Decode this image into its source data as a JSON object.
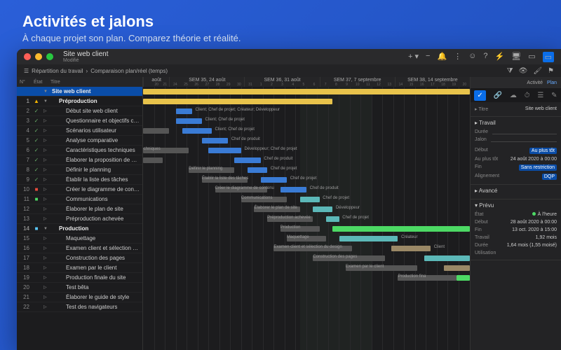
{
  "hero": {
    "title": "Activités et jalons",
    "subtitle": "À chaque projet son plan. Comparez théorie et réalité."
  },
  "window": {
    "title": "Site web client",
    "subtitle": "Modifié"
  },
  "breadcrumbs": {
    "seg1": "Répartition du travail",
    "seg2": "Comparaison plan/réel (temps)"
  },
  "left_header": {
    "num": "N°",
    "state": "État",
    "title": "Titre"
  },
  "right_tabs": {
    "a": "Activité",
    "b": "Plan"
  },
  "tasks": [
    {
      "n": "",
      "st": "",
      "tri": "▼",
      "t": "Site web client",
      "cls": "sel bold",
      "ind": 0
    },
    {
      "n": "1",
      "st": "▲",
      "sc": "warn",
      "tri": "▼",
      "t": "Préproduction",
      "cls": "bold",
      "ind": 1
    },
    {
      "n": "2",
      "st": "✓",
      "sc": "ck",
      "tri": "▷",
      "t": "Début site web client",
      "ind": 2
    },
    {
      "n": "3",
      "st": "✓",
      "sc": "ck",
      "tri": "▷",
      "t": "Questionnaire et objectifs client",
      "ind": 2
    },
    {
      "n": "4",
      "st": "✓",
      "sc": "ck",
      "tri": "▷",
      "t": "Scénarios utilisateur",
      "ind": 2
    },
    {
      "n": "5",
      "st": "✓",
      "sc": "ck",
      "tri": "▷",
      "t": "Analyse comparative",
      "ind": 2
    },
    {
      "n": "6",
      "st": "✓",
      "sc": "ck",
      "tri": "▷",
      "t": "Caractéristiques techniques",
      "ind": 2
    },
    {
      "n": "7",
      "st": "✓",
      "sc": "ck",
      "tri": "▷",
      "t": "Élaborer la proposition de projet",
      "ind": 2
    },
    {
      "n": "8",
      "st": "✓",
      "sc": "ck",
      "tri": "▷",
      "t": "Définir le planning",
      "ind": 2
    },
    {
      "n": "9",
      "st": "✓",
      "sc": "ck",
      "tri": "▷",
      "t": "Établir la liste des tâches",
      "ind": 2
    },
    {
      "n": "10",
      "st": "■",
      "sc": "redsq",
      "tri": "▷",
      "t": "Créer le diagramme de contenu",
      "ind": 2
    },
    {
      "n": "11",
      "st": "■",
      "sc": "grnsq",
      "tri": "▷",
      "t": "Communications",
      "ind": 2
    },
    {
      "n": "12",
      "st": "",
      "tri": "▷",
      "t": "Élaborer le plan de site",
      "ind": 2
    },
    {
      "n": "13",
      "st": "",
      "tri": "▷",
      "t": "Préproduction achevée",
      "ind": 2
    },
    {
      "n": "14",
      "st": "■",
      "sc": "bluesq",
      "tri": "▼",
      "t": "Production",
      "cls": "bold",
      "ind": 1
    },
    {
      "n": "15",
      "st": "",
      "tri": "▷",
      "t": "Maquettage",
      "ind": 2
    },
    {
      "n": "16",
      "st": "",
      "tri": "▷",
      "t": "Examen client et sélection du design",
      "ind": 2
    },
    {
      "n": "17",
      "st": "",
      "tri": "▷",
      "t": "Construction des pages",
      "ind": 2
    },
    {
      "n": "18",
      "st": "",
      "tri": "▷",
      "t": "Examen par le client",
      "ind": 2
    },
    {
      "n": "19",
      "st": "",
      "tri": "▷",
      "t": "Production finale du site",
      "ind": 2
    },
    {
      "n": "20",
      "st": "",
      "tri": "▷",
      "t": "Test bêta",
      "ind": 2
    },
    {
      "n": "21",
      "st": "",
      "tri": "▷",
      "t": "Élaborer le guide de style",
      "ind": 2
    },
    {
      "n": "22",
      "st": "",
      "tri": "▷",
      "t": "Test des navigateurs",
      "ind": 2
    }
  ],
  "weeks": [
    {
      "label": "août",
      "days": [
        "",
        "20",
        "21"
      ]
    },
    {
      "label": "SEM 35, 24 août",
      "days": [
        "24",
        "25",
        "26",
        "27",
        "28",
        "29",
        "30"
      ]
    },
    {
      "label": "SEM 36, 31 août",
      "days": [
        "31",
        "1",
        "2",
        "3",
        "4",
        "5",
        "6"
      ]
    },
    {
      "label": "SEM 37, 7 septembre",
      "days": [
        "7",
        "8",
        "9",
        "10",
        "11",
        "12",
        "13"
      ]
    },
    {
      "label": "SEM 38, 14 septembre",
      "days": [
        "14",
        "15",
        "16",
        "17",
        "18",
        "19",
        "20"
      ]
    }
  ],
  "bar_labels": {
    "l0": "ion",
    "l1": "Client; Chef de projet; Créateur; Développeur",
    "l2": "Client; Chef de projet",
    "l3": "teur",
    "l4": "Client; Chef de projet",
    "l5": "Chef de produit",
    "l6": "tions techniques",
    "l7": "Développeur; Chef de projet",
    "l8": "Chef de produit",
    "l9": "Définir le planning",
    "l10": "Chef de projet",
    "l11": "Établir la liste des tâches",
    "l12": "Chef de projet",
    "l13": "Créer le diagramme de contenu",
    "l14": "Chef de produit",
    "l15": "Communications",
    "l16": "Chef de projet",
    "l17": "Élaborer le plan de site",
    "l18": "Développeur",
    "l19": "Préproduction achevée",
    "l20": "Chef de projet",
    "l21": "Production",
    "l22": "Maquettage",
    "l23": "Créateur",
    "l24": "Examen client et sélection du design",
    "l25": "Client",
    "l26": "Construction des pages",
    "l27": "Examen par le client",
    "l28": "Production fina"
  },
  "inspector": {
    "titre_h": "Titre",
    "titre_v": "Site web client",
    "travail_h": "Travail",
    "duree_k": "Durée",
    "jalon_k": "Jalon",
    "debut_k": "Début",
    "debut_v": "Au plus tôt",
    "auplus_k": "Au plus tôt",
    "auplus_v": "24 août 2020 à 00:00",
    "fin_k": "Fin",
    "fin_v": "Sans restriction",
    "align_k": "Alignement",
    "align_v": "DQP",
    "avance_h": "Avancé",
    "prevu_h": "Prévu",
    "etat_k": "État",
    "etat_v": "À l'heure",
    "pdebut_k": "Début",
    "pdebut_v": "28 août 2020 à 00:00",
    "pfin_k": "Fin",
    "pfin_v": "13 oct. 2020 à 15:00",
    "ptrav_k": "Travail",
    "ptrav_v": "1,92 mois",
    "pduree_k": "Durée",
    "pduree_v": "1,64 mois (1,55 moisé)",
    "util_k": "Utilisation"
  }
}
